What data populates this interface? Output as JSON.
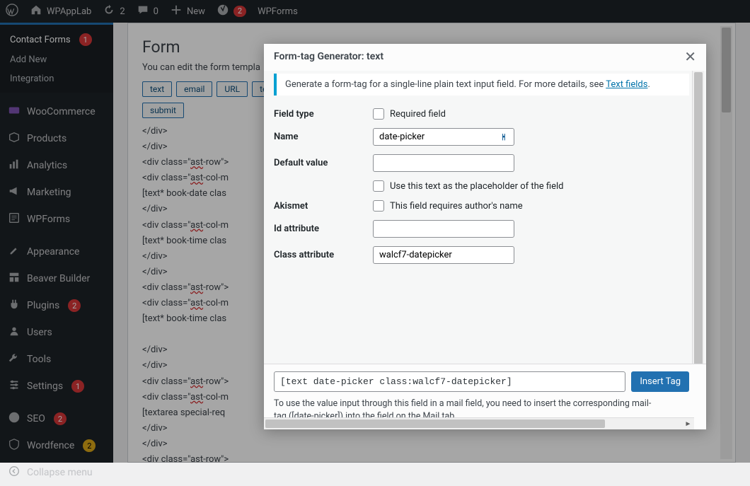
{
  "adminbar": {
    "site_name": "WPAppLab",
    "updates": "2",
    "comments": "0",
    "new_label": "New",
    "yoast_count": "2",
    "wpforms": "WPForms"
  },
  "sidebar": {
    "contact_forms": "Contact Forms",
    "contact_forms_badge": "1",
    "add_new": "Add New",
    "integration": "Integration",
    "woocommerce": "WooCommerce",
    "products": "Products",
    "analytics": "Analytics",
    "marketing": "Marketing",
    "wpforms": "WPForms",
    "appearance": "Appearance",
    "beaver_builder": "Beaver Builder",
    "plugins": "Plugins",
    "plugins_badge": "2",
    "users": "Users",
    "tools": "Tools",
    "settings": "Settings",
    "settings_badge": "1",
    "seo": "SEO",
    "seo_badge": "2",
    "wordfence": "Wordfence",
    "wordfence_badge": "2",
    "collapse": "Collapse menu"
  },
  "editor": {
    "heading": "Form",
    "subtext": "You can edit the form templa",
    "tags": [
      "text",
      "email",
      "URL",
      "tel"
    ],
    "submit": "submit",
    "code_lines": [
      "</div>",
      "</div>",
      "<div class=\"ast-row\">",
      "<div class=\"ast-col-m",
      "[text* book-date clas",
      "</div>",
      "<div class=\"ast-col-m",
      "[text* book-time clas",
      "</div>",
      "</div>",
      "<div class=\"ast-row\">",
      "<div class=\"ast-col-m",
      "[text* book-time clas",
      "",
      "</div>",
      "</div>",
      "<div class=\"ast-row\">",
      "<div class=\"ast-col-m",
      "[textarea special-req",
      "</div>",
      "</div>",
      "<div class=\"ast-row\">"
    ]
  },
  "modal": {
    "title": "Form-tag Generator: text",
    "info_pre": "Generate a form-tag for a single-line plain text input field. For more details, see ",
    "info_link": "Text fields",
    "info_post": ".",
    "field_type_label": "Field type",
    "required_label": "Required field",
    "name_label": "Name",
    "name_value": "date-picker",
    "default_label": "Default value",
    "placeholder_label": "Use this text as the placeholder of the field",
    "akismet_label": "Akismet",
    "akismet_check": "This field requires author's name",
    "id_label": "Id attribute",
    "class_label": "Class attribute",
    "class_value": "walcf7-datepicker",
    "output_tag": "[text date-picker class:walcf7-datepicker]",
    "insert_label": "Insert Tag",
    "foot_note_1": "To use the value input through this field in a mail field, you need to insert the corresponding mail-",
    "foot_note_2": "tag ([date-picker]) into the field on the Mail tab"
  }
}
